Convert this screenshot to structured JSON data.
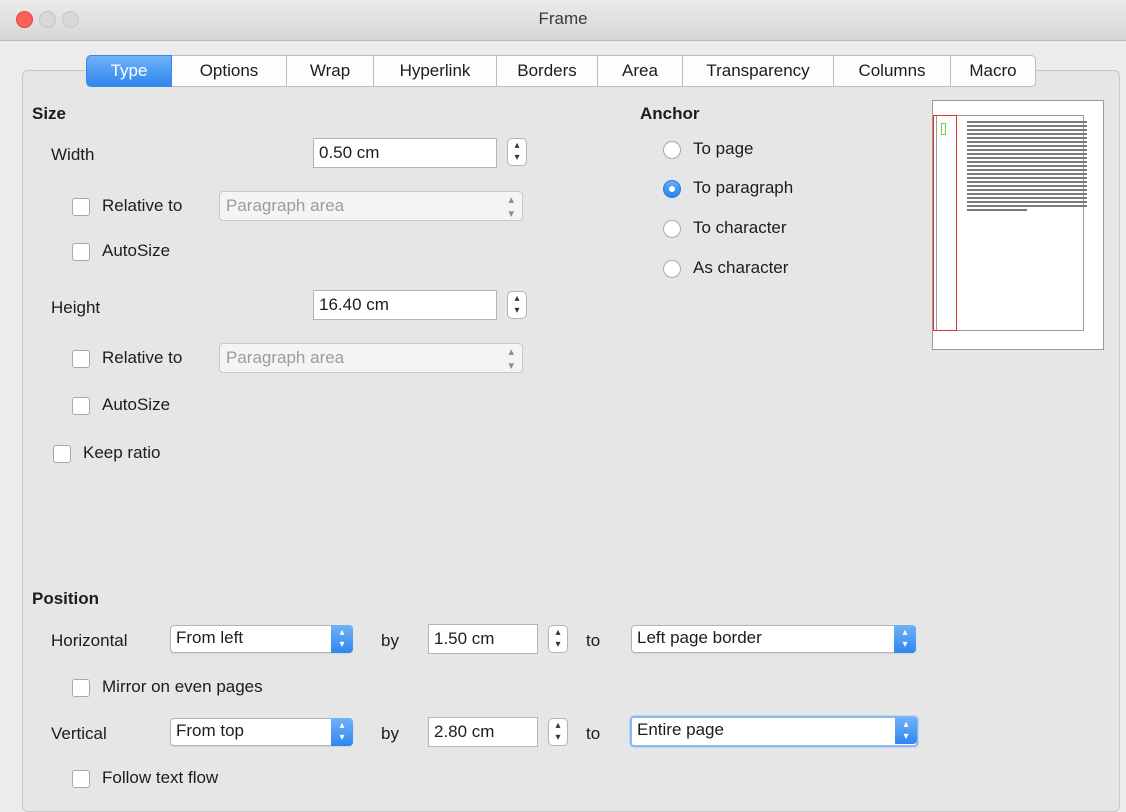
{
  "window": {
    "title": "Frame"
  },
  "tabs": [
    {
      "label": "Type",
      "active": true
    },
    {
      "label": "Options",
      "active": false
    },
    {
      "label": "Wrap",
      "active": false
    },
    {
      "label": "Hyperlink",
      "active": false
    },
    {
      "label": "Borders",
      "active": false
    },
    {
      "label": "Area",
      "active": false
    },
    {
      "label": "Transparency",
      "active": false
    },
    {
      "label": "Columns",
      "active": false
    },
    {
      "label": "Macro",
      "active": false
    }
  ],
  "size": {
    "heading": "Size",
    "width_label": "Width",
    "width_value": "0.50 cm",
    "width_relative_label": "Relative to",
    "width_relative_value": "Paragraph area",
    "width_autosize_label": "AutoSize",
    "height_label": "Height",
    "height_value": "16.40 cm",
    "height_relative_label": "Relative to",
    "height_relative_value": "Paragraph area",
    "height_autosize_label": "AutoSize",
    "keep_ratio_label": "Keep ratio"
  },
  "anchor": {
    "heading": "Anchor",
    "options": [
      {
        "label": "To page",
        "selected": false
      },
      {
        "label": "To paragraph",
        "selected": true
      },
      {
        "label": "To character",
        "selected": false
      },
      {
        "label": "As character",
        "selected": false
      }
    ]
  },
  "position": {
    "heading": "Position",
    "horizontal_label": "Horizontal",
    "horizontal_value": "From left",
    "horizontal_by_label": "by",
    "horizontal_by_value": "1.50 cm",
    "horizontal_to_label": "to",
    "horizontal_to_value": "Left page border",
    "mirror_label": "Mirror on even pages",
    "vertical_label": "Vertical",
    "vertical_value": "From top",
    "vertical_by_label": "by",
    "vertical_by_value": "2.80 cm",
    "vertical_to_label": "to",
    "vertical_to_value": "Entire page",
    "follow_label": "Follow text flow"
  },
  "colors": {
    "accent": "#2f86f0",
    "close_button": "#fc5f57",
    "preview_frame": "#e0322b"
  }
}
